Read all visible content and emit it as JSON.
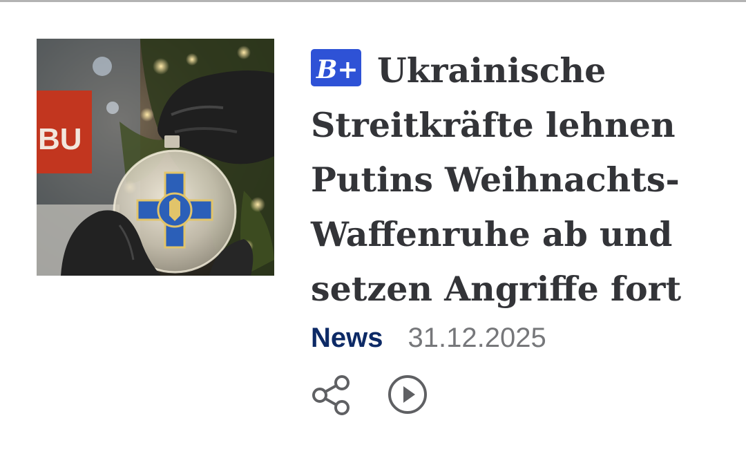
{
  "article": {
    "badge_label": "B+",
    "headline": "Ukrainische Streitkräfte lehnen Putins Weihnachts-Waffenruhe ab und setzen Angriffe fort",
    "category": "News",
    "date": "31.12.2025"
  },
  "image": {
    "overlay_text": "BU"
  },
  "icons": {
    "share": "share-icon",
    "play": "play-icon",
    "badge": "bild-plus-icon"
  },
  "colors": {
    "headline": "#333438",
    "category": "#0d2a66",
    "date": "#76777a",
    "badge_bg": "#2e52d6",
    "icon": "#5f6063"
  }
}
